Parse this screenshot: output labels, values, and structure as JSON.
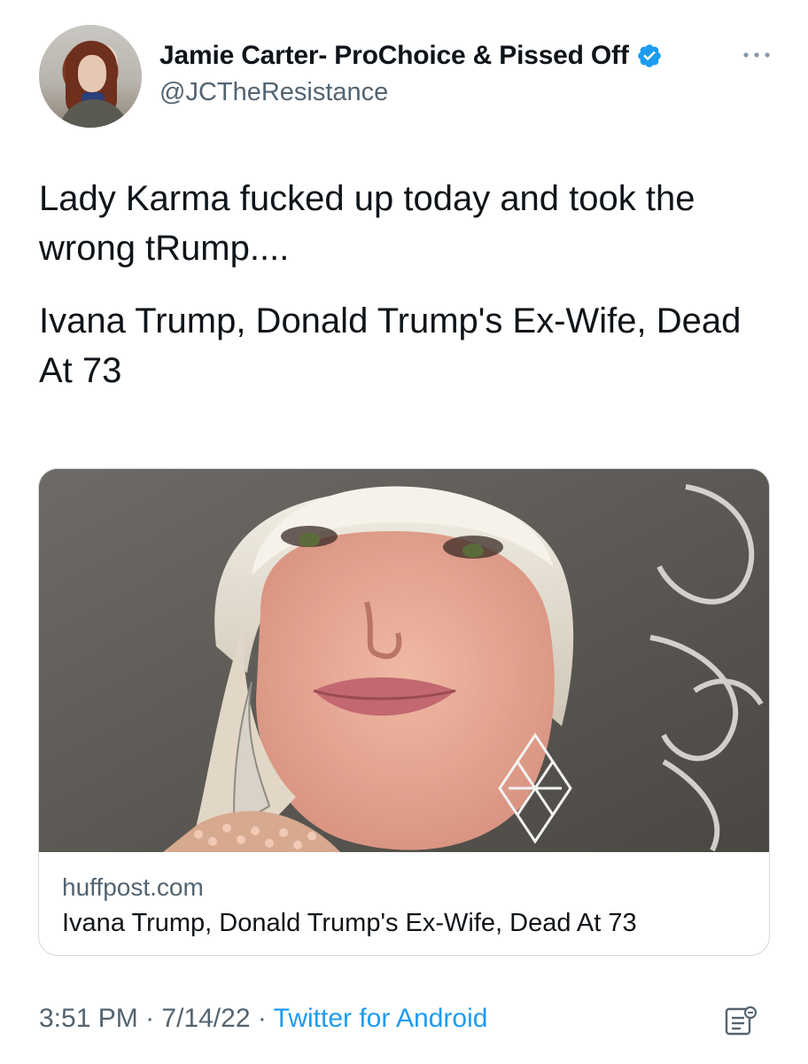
{
  "tweet": {
    "author": {
      "display_name": "Jamie Carter- ProChoice & Pissed Off",
      "handle": "@JCTheResistance",
      "verified": true
    },
    "text_paragraphs": [
      "Lady Karma fucked up today and took the wrong tRump....",
      "Ivana Trump, Donald Trump's Ex-Wife, Dead At 73"
    ],
    "card": {
      "domain": "huffpost.com",
      "title": "Ivana Trump, Donald Trump's Ex-Wife, Dead At 73",
      "image_alt": "Close-up photo of Ivana Trump with blonde bangs and diamond earrings"
    },
    "time": "3:51 PM",
    "separator": "·",
    "date": "7/14/22",
    "source": "Twitter for Android"
  },
  "icons": {
    "verified": "verified-badge-icon",
    "more": "more-options-icon",
    "analytics": "tweet-analytics-icon"
  },
  "colors": {
    "text": "#0f1419",
    "secondary": "#536471",
    "accent": "#1d9bf0",
    "border": "#cfd9de"
  }
}
